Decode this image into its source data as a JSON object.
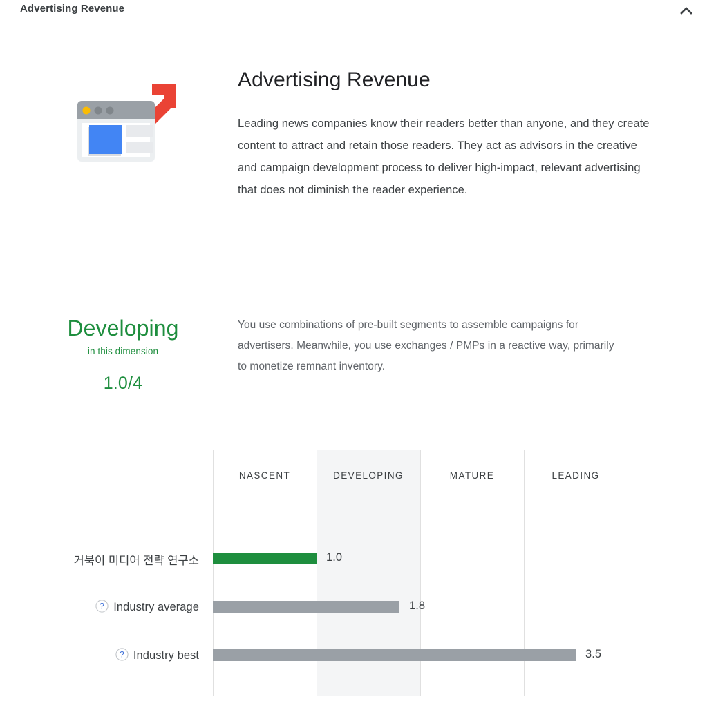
{
  "panel": {
    "title": "Advertising Revenue",
    "collapse_icon": "chevron-up-icon"
  },
  "hero": {
    "icon": "browser-window-growth-icon",
    "title": "Advertising Revenue",
    "description": "Leading news companies know their readers better than anyone, and they create content to attract and retain those readers. They act as advisors in the creative and campaign development process to deliver high-impact, relevant advertising that does not diminish the reader experience."
  },
  "score": {
    "level": "Developing",
    "sublabel": "in this dimension",
    "value": "1.0/4",
    "color": "#1e8e3e",
    "level_description": "You use combinations of pre-built segments to assemble campaigns for advertisers. Meanwhile, you use exchanges / PMPs in a reactive way, primarily to monetize remnant inventory."
  },
  "chart_data": {
    "type": "bar",
    "title": "",
    "xlabel": "",
    "ylabel": "",
    "orientation": "horizontal",
    "xlim": [
      0,
      4
    ],
    "grid": true,
    "legend": "none",
    "band_labels": [
      "NASCENT",
      "DEVELOPING",
      "MATURE",
      "LEADING"
    ],
    "highlighted_band": "DEVELOPING",
    "categories": [
      "거북이 미디어 전략 연구소",
      "Industry average",
      "Industry best"
    ],
    "values": [
      1.0,
      1.8,
      3.5
    ],
    "value_labels": [
      "1.0",
      "1.8",
      "3.5"
    ],
    "bar_colors": [
      "#1e8e3e",
      "#9aa0a6",
      "#9aa0a6"
    ],
    "rows": [
      {
        "label": "거북이 미디어 전략 연구소",
        "value": 1.0,
        "value_label": "1.0",
        "color": "#1e8e3e",
        "has_help_icon": false
      },
      {
        "label": "Industry average",
        "value": 1.8,
        "value_label": "1.8",
        "color": "#9aa0a6",
        "has_help_icon": true
      },
      {
        "label": "Industry best",
        "value": 3.5,
        "value_label": "3.5",
        "color": "#9aa0a6",
        "has_help_icon": true
      }
    ]
  }
}
